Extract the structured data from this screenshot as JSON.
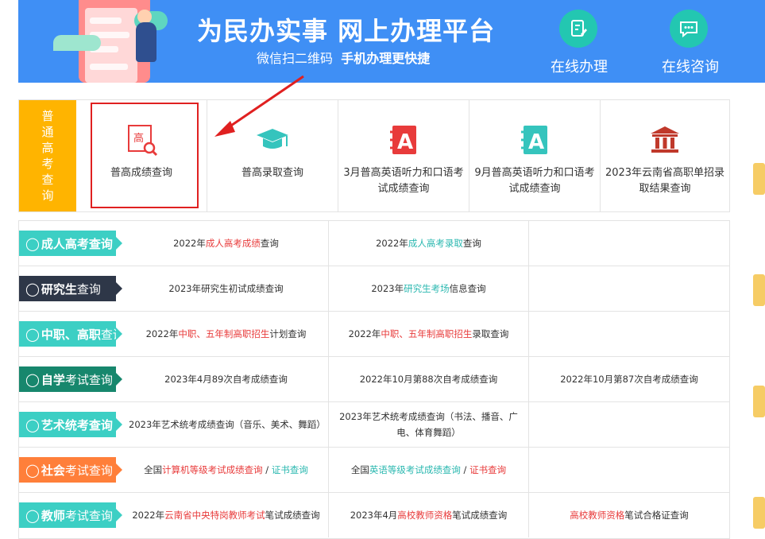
{
  "banner": {
    "title": "为民办实事  网上办理平台",
    "sub_plain": "微信扫二维码",
    "sub_bold": "手机办理更快捷",
    "online_handle": "在线办理",
    "online_consult": "在线咨询",
    "bg_color": "#3f8ff5"
  },
  "pugao": {
    "side_label": "普通高考查询",
    "items": [
      {
        "label": "普高成绩查询",
        "icon": "gao-search-icon"
      },
      {
        "label": "普高录取查询",
        "icon": "graduation-cap-icon"
      },
      {
        "label": "3月普高英语听力和口语考试成绩查询",
        "icon": "letter-a-book-icon"
      },
      {
        "label": "9月普高英语听力和口语考试成绩查询",
        "icon": "letter-a-book-icon"
      },
      {
        "label": "2023年云南省高职单招录取结果查询",
        "icon": "institution-icon"
      }
    ]
  },
  "rows": [
    {
      "tag_a": "成人高考查询",
      "tag_b": "",
      "color": "#3ccfc4",
      "c1": [
        "2022年",
        "成人高考成绩",
        "查询"
      ],
      "c2": [
        "2022年",
        "成人高考录取",
        "查询"
      ],
      "c3": [
        "",
        "",
        ""
      ]
    },
    {
      "tag_a": "研究生",
      "tag_b": "查询",
      "color": "#2e3748",
      "c1": [
        "2023年研究生初试成绩查询",
        "",
        ""
      ],
      "c2": [
        "2023年",
        "研究生考场",
        "信息查询"
      ],
      "c3": [
        "",
        "",
        ""
      ]
    },
    {
      "tag_a": "中职、高职",
      "tag_b": "查询",
      "color": "#3ccfc4",
      "c1": [
        "2022年",
        "中职、五年制高职招生",
        "计划查询"
      ],
      "c2": [
        "2022年",
        "中职、五年制高职招生",
        "录取查询"
      ],
      "c3": [
        "",
        "",
        ""
      ]
    },
    {
      "tag_a": "自学",
      "tag_b": "考试查询",
      "color": "#17876d",
      "c1": [
        "2023年4月89次自考成绩查询",
        "",
        ""
      ],
      "c2": [
        "2022年10月第88次自考成绩查询",
        "",
        ""
      ],
      "c3": [
        "2022年10月第87次自考成绩查询",
        "",
        ""
      ]
    },
    {
      "tag_a": "艺术统考查询",
      "tag_b": "",
      "color": "#3ccfc4",
      "c1": [
        "2023年艺术统考成绩查询（音乐、美术、舞蹈）",
        "",
        ""
      ],
      "c2": [
        "2023年艺术统考成绩查询（书法、播音、广电、体育舞蹈）",
        "",
        ""
      ],
      "c3": [
        "",
        "",
        ""
      ]
    },
    {
      "tag_a": "社会",
      "tag_b": "考试查询",
      "color": "#ff7f3a",
      "c1_parts": [
        "全国",
        "计算机等级考试成绩查询",
        " / ",
        "证书查询"
      ],
      "c2_parts": [
        "全国",
        "英语等级考试成绩查询",
        " / ",
        "证书查询"
      ]
    },
    {
      "tag_a": "教师",
      "tag_b": "考试查询",
      "color": "#3ccfc4",
      "c1": [
        "2022年",
        "云南省中央特岗教师考试",
        "笔试成绩查询"
      ],
      "c2": [
        "2023年4月",
        "高校教师资格",
        "笔试成绩查询"
      ],
      "c3": [
        "",
        "高校教师资格",
        "笔试合格证查询"
      ]
    }
  ]
}
